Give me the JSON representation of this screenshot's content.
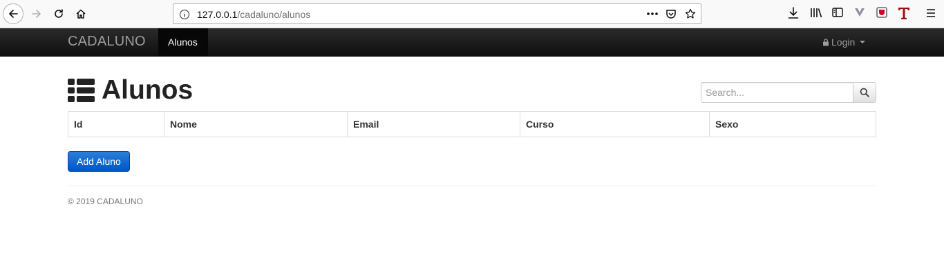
{
  "browser": {
    "url_host": "127.0.0.1",
    "url_path": "/cadaluno/alunos"
  },
  "navbar": {
    "brand": "CADALUNO",
    "active_item": "Alunos",
    "login_label": "Login"
  },
  "main": {
    "title": "Alunos",
    "search_placeholder": "Search...",
    "table_headers": [
      "Id",
      "Nome",
      "Email",
      "Curso",
      "Sexo"
    ],
    "add_button": "Add Aluno"
  },
  "footer": {
    "text": "© 2019 CADALUNO"
  },
  "colors": {
    "navbar": "#222222",
    "primary_button": "#0055cc"
  }
}
